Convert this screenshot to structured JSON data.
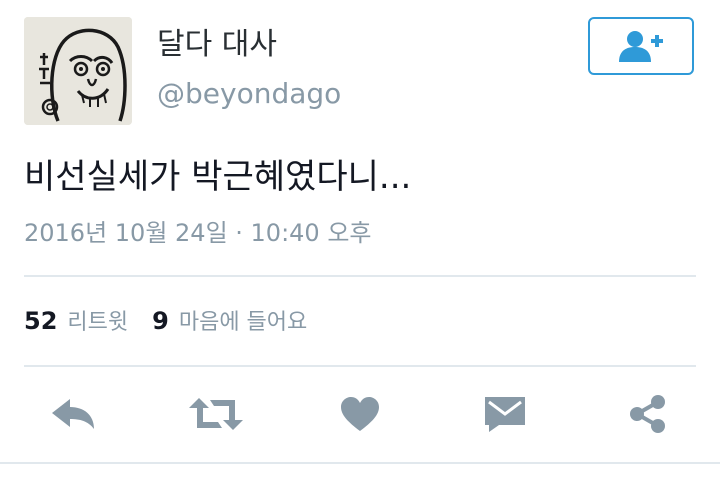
{
  "profile": {
    "display_name": "달다 대사",
    "handle": "@beyondago",
    "avatar_icon": "daruma-avatar",
    "follow_icon": "add-user-icon"
  },
  "tweet": {
    "text": "비선실세가 박근혜였다니...",
    "timestamp": "2016년 10월 24일 · 10:40 오후"
  },
  "stats": {
    "retweets_count": "52",
    "retweets_label": "리트윗",
    "likes_count": "9",
    "likes_label": "마음에 들어요"
  },
  "actions": [
    "reply-icon",
    "retweet-icon",
    "heart-icon",
    "message-icon",
    "share-icon"
  ],
  "colors": {
    "accent": "#2f9ad8",
    "icon_gray": "#8899a6",
    "divider": "#e1e8ed",
    "text": "#141823"
  }
}
